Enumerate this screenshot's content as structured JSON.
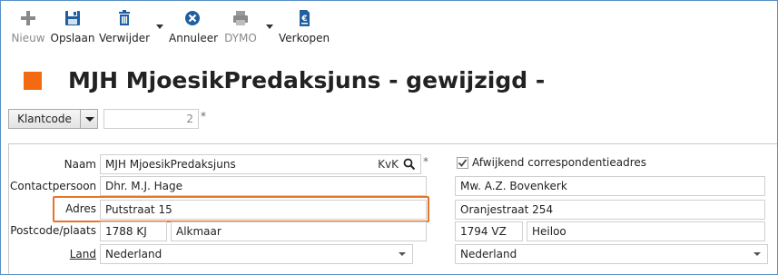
{
  "toolbar": {
    "new_label": "Nieuw",
    "save_label": "Opslaan",
    "delete_label": "Verwijder",
    "cancel_label": "Annuleer",
    "dymo_label": "DYMO",
    "sell_label": "Verkopen"
  },
  "header": {
    "title": "MJH MjoesikPredaksjuns - gewijzigd -",
    "accent_color": "#f26b13"
  },
  "klantcode": {
    "button_label": "Klantcode",
    "value": "2",
    "required_mark": "*"
  },
  "form": {
    "labels": {
      "naam": "Naam",
      "contactpersoon": "Contactpersoon",
      "adres": "Adres",
      "postcode_plaats": "Postcode/plaats",
      "land": "Land"
    },
    "naam": "MJH MjoesikPredaksjuns",
    "kvk": "KvK",
    "naam_required_mark": "*",
    "contactpersoon": "Dhr. M.J. Hage",
    "adres": "Putstraat 15",
    "postcode": "1788 KJ",
    "plaats": "Alkmaar",
    "land": "Nederland"
  },
  "correspondence": {
    "checkbox_label": "Afwijkend correspondentieadres",
    "checked": true,
    "naam": "Mw. A.Z. Bovenkerk",
    "adres": "Oranjestraat 254",
    "postcode": "1794 VZ",
    "plaats": "Heiloo",
    "land": "Nederland"
  },
  "highlight_color": "#e8742a"
}
